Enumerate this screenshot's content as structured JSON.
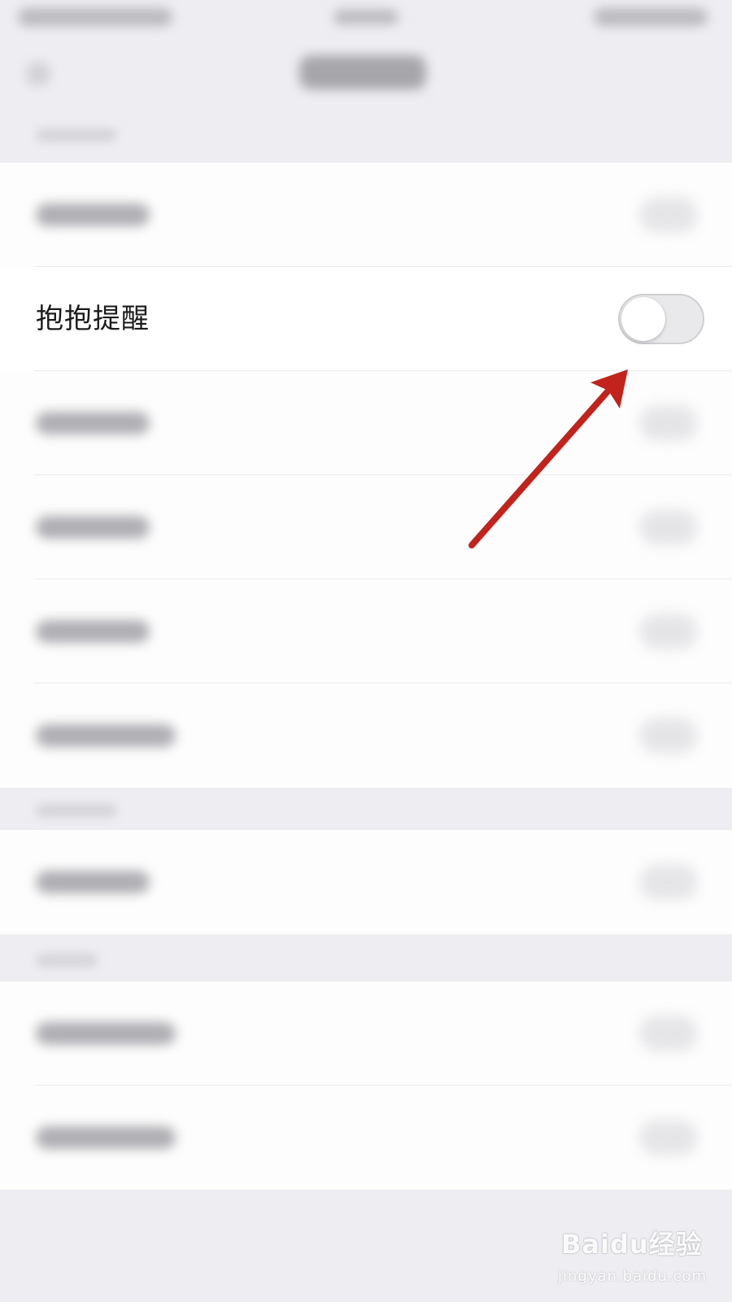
{
  "setting_row": {
    "label": "抱抱提醒",
    "toggle_state": "off"
  },
  "colors": {
    "background": "#eeeef2",
    "cell_background": "#fdfdfd",
    "toggle_off_track": "#e9e9eb",
    "arrow": "#c2231c"
  },
  "watermark": {
    "brand": "Baidu经验",
    "url": "jingyan.baidu.com"
  }
}
